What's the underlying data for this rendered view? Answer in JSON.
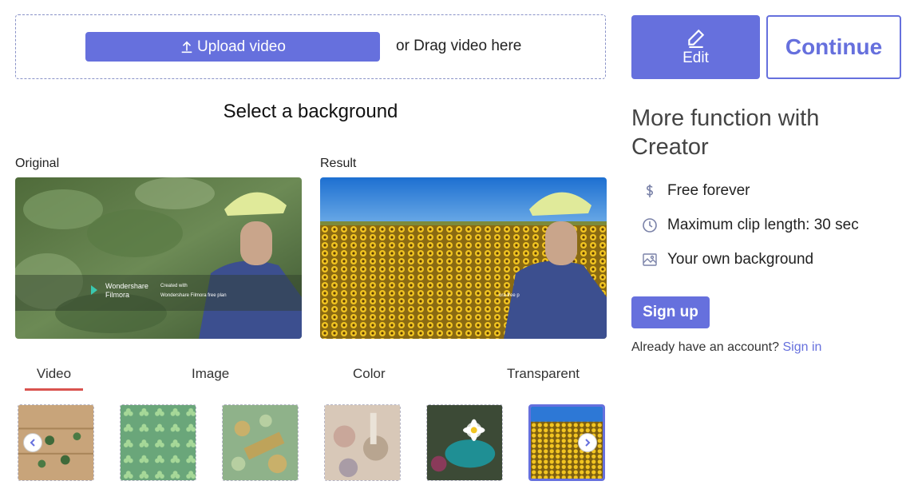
{
  "upload": {
    "button_label": "Upload video",
    "drag_text": "or Drag video here",
    "upload_icon": "upload-arrow-icon"
  },
  "actions": {
    "edit_label": "Edit",
    "edit_icon": "pencil-icon",
    "continue_label": "Continue"
  },
  "main": {
    "select_title": "Select a background",
    "original_label": "Original",
    "result_label": "Result",
    "original_watermark": {
      "brand_line1": "Wondershare",
      "brand_line2": "Filmora",
      "created_line1": "Created with",
      "created_line2": "Wondershare Filmora free plan"
    },
    "result_watermark": "ora free p"
  },
  "tabs": [
    {
      "label": "Video",
      "active": true
    },
    {
      "label": "Image",
      "active": false
    },
    {
      "label": "Color",
      "active": false
    },
    {
      "label": "Transparent",
      "active": false
    }
  ],
  "thumbnails": [
    {
      "name": "clover-wood",
      "selected": false
    },
    {
      "name": "clover-pattern",
      "selected": false
    },
    {
      "name": "coins-lucky",
      "selected": false
    },
    {
      "name": "flowers-light",
      "selected": false
    },
    {
      "name": "white-flower",
      "selected": false
    },
    {
      "name": "sunflower-field",
      "selected": true
    }
  ],
  "sidebar": {
    "title": "More function with Creator",
    "features": [
      {
        "icon": "dollar-icon",
        "label": "Free forever"
      },
      {
        "icon": "clock-icon",
        "label": "Maximum clip length: 30 sec"
      },
      {
        "icon": "image-icon",
        "label": "Your own background"
      }
    ],
    "signup_label": "Sign up",
    "account_prompt": "Already have an account?",
    "signin_label": "Sign in"
  },
  "colors": {
    "accent": "#6670dd",
    "active_tab_underline": "#d9534f"
  }
}
